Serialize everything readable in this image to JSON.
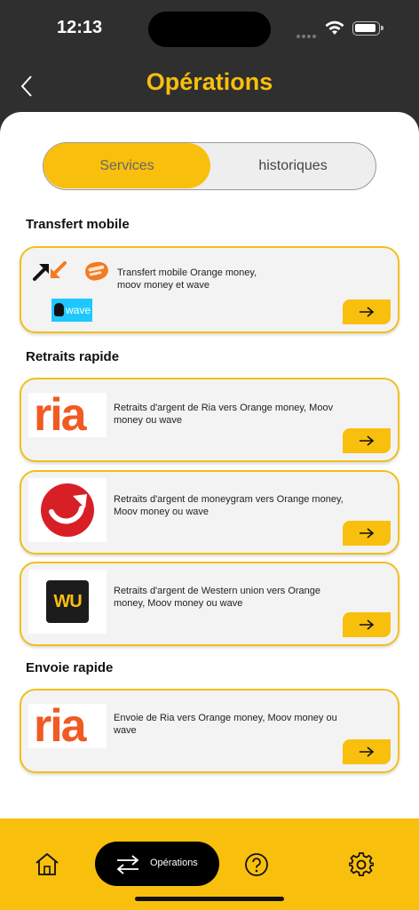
{
  "status_bar": {
    "time": "12:13"
  },
  "header": {
    "title": "Opérations"
  },
  "segments": {
    "active": "Services",
    "inactive": "historiques"
  },
  "sections": {
    "transfer": "Transfert mobile",
    "withdraw": "Retraits rapide",
    "send": "Envoie rapide"
  },
  "cards": {
    "transfer": {
      "text": "Transfert mobile Orange money, moov money et wave",
      "logo_wave": "wave",
      "logo_moov": "Moov money"
    },
    "ria_withdraw": {
      "text": "Retraits d'argent de Ria vers Orange money, Moov money ou wave",
      "logo": "ria"
    },
    "moneygram_withdraw": {
      "text": "Retraits d'argent de moneygram vers Orange money, Moov money ou wave"
    },
    "wu_withdraw": {
      "text": "Retraits d'argent de Western union vers Orange money, Moov money ou wave",
      "logo": "WU"
    },
    "ria_send": {
      "text": "Envoie de Ria vers Orange money, Moov money ou wave",
      "logo": "ria"
    }
  },
  "tabbar": {
    "active_label": "Opérations"
  },
  "colors": {
    "accent": "#f9bf0d",
    "dark": "#2f2f2f",
    "ria": "#f15a22",
    "moneygram": "#d91f26",
    "wu_bg": "#1c1c1c",
    "wave": "#1dc8ff"
  }
}
